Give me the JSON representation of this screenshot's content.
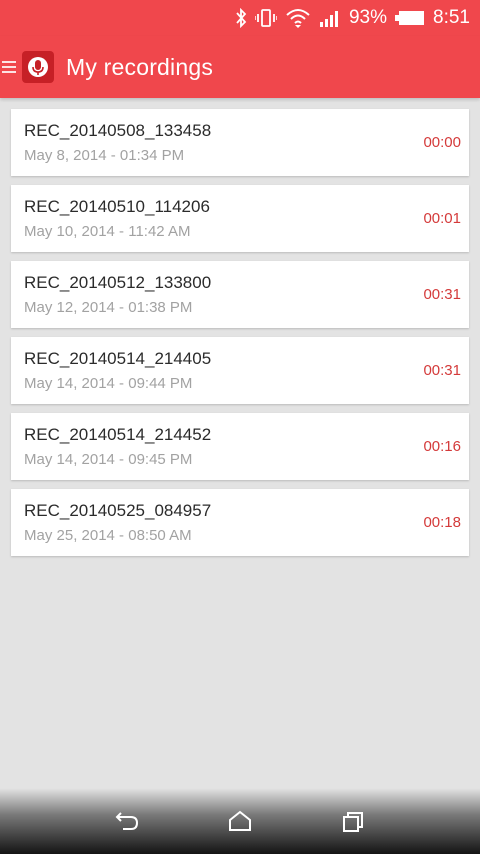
{
  "status_bar": {
    "battery_percent": "93%",
    "time": "8:51",
    "icons": [
      "bluetooth-icon",
      "vibrate-icon",
      "wifi-icon",
      "signal-icon",
      "battery-icon"
    ]
  },
  "app_bar": {
    "title": "My recordings",
    "color": "#f0474c",
    "icons": [
      "menu-icon",
      "microphone-app-icon"
    ]
  },
  "recordings": [
    {
      "name": "REC_20140508_133458",
      "date": "May 8, 2014 - 01:34 PM",
      "duration": "00:00"
    },
    {
      "name": "REC_20140510_114206",
      "date": "May 10, 2014 - 11:42 AM",
      "duration": "00:01"
    },
    {
      "name": "REC_20140512_133800",
      "date": "May 12, 2014 - 01:38 PM",
      "duration": "00:31"
    },
    {
      "name": "REC_20140514_214405",
      "date": "May 14, 2014 - 09:44 PM",
      "duration": "00:31"
    },
    {
      "name": "REC_20140514_214452",
      "date": "May 14, 2014 - 09:45 PM",
      "duration": "00:16"
    },
    {
      "name": "REC_20140525_084957",
      "date": "May 25, 2014 - 08:50 AM",
      "duration": "00:18"
    }
  ],
  "nav_bar": {
    "icons": [
      "back-icon",
      "home-icon",
      "recent-apps-icon"
    ]
  },
  "colors": {
    "accent": "#f0474c",
    "duration_text": "#d43a3a",
    "background": "#e3e3e3"
  }
}
